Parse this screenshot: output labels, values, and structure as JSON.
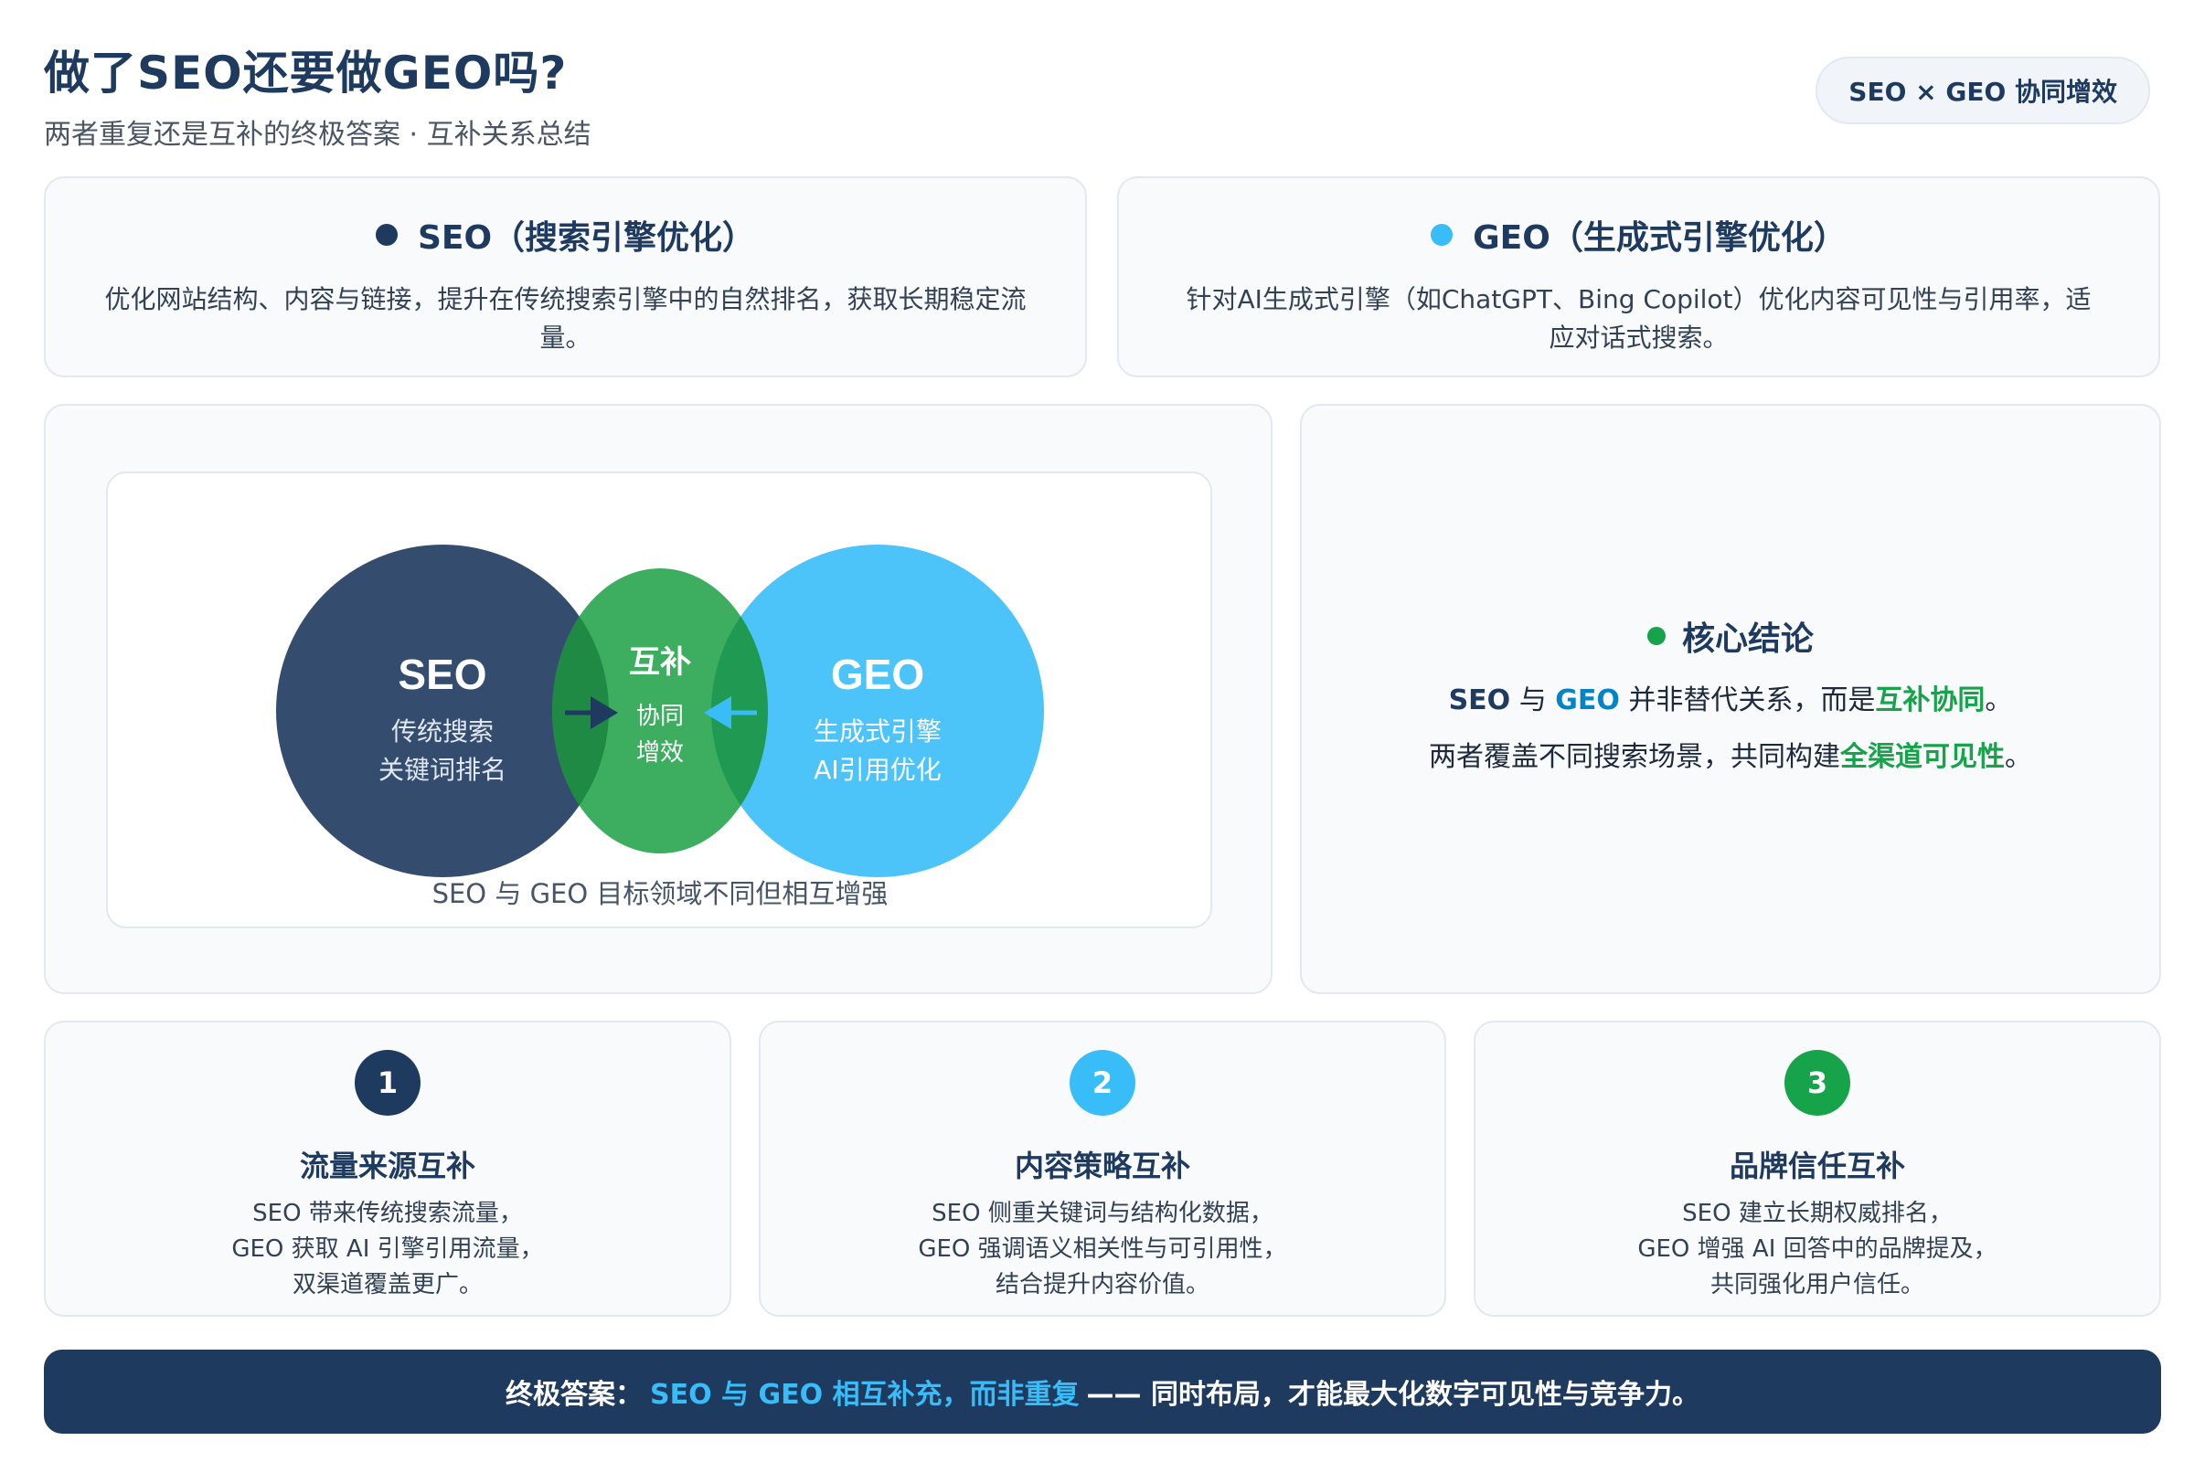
{
  "header": {
    "title": "做了SEO还要做GEO吗?",
    "subtitle": "两者重复还是互补的终极答案 · 互补关系总结",
    "badge": "SEO × GEO 协同增效"
  },
  "definitions": [
    {
      "title": "SEO（搜索引擎优化）",
      "text": "优化网站结构、内容与链接，提升在传统搜索引擎中的自然排名，获取长期稳定流量。",
      "dot_color": "#1e3a5f"
    },
    {
      "title": "GEO（生成式引擎优化）",
      "text": "针对AI生成式引擎（如ChatGPT、Bing Copilot）优化内容可见性与引用率，适应对话式搜索。",
      "dot_color": "#38bdf8"
    }
  ],
  "venn": {
    "left": {
      "title": "SEO",
      "line1": "传统搜索",
      "line2": "关键词排名",
      "color": "#1e3a5f"
    },
    "middle": {
      "title": "互补",
      "line1": "协同",
      "line2": "增效",
      "color": "#22a34a"
    },
    "right": {
      "title": "GEO",
      "line1": "生成式引擎",
      "line2": "AI引用优化",
      "color": "#38bdf8"
    },
    "caption": "SEO 与 GEO 目标领域不同但相互增强"
  },
  "conclusion": {
    "title": "核心结论",
    "dot_color": "#16a34a",
    "line1": {
      "seo": "SEO",
      "with": " 与 ",
      "geo": "GEO",
      "mid": " 并非替代关系，而是",
      "emph": "互补协同",
      "end": "。"
    },
    "line2": {
      "start": "两者覆盖不同搜索场景，共同构建",
      "emph": "全渠道可见性",
      "end": "。"
    }
  },
  "features": [
    {
      "num": "1",
      "color": "#1e3a5f",
      "title": "流量来源互补",
      "lines": [
        "SEO 带来传统搜索流量，",
        "GEO 获取 AI 引擎引用流量，",
        "双渠道覆盖更广。"
      ]
    },
    {
      "num": "2",
      "color": "#38bdf8",
      "title": "内容策略互补",
      "lines": [
        "SEO 侧重关键词与结构化数据，",
        "GEO 强调语义相关性与可引用性，",
        "结合提升内容价值。"
      ]
    },
    {
      "num": "3",
      "color": "#16a34a",
      "title": "品牌信任互补",
      "lines": [
        "SEO 建立长期权威排名，",
        "GEO 增强 AI 回答中的品牌提及，",
        "共同强化用户信任。"
      ]
    }
  ],
  "banner": {
    "prefix": "终极答案：",
    "highlight": "SEO 与 GEO 相互补充，而非重复",
    "suffix": "—— 同时布局，才能最大化数字可见性与竞争力。"
  }
}
